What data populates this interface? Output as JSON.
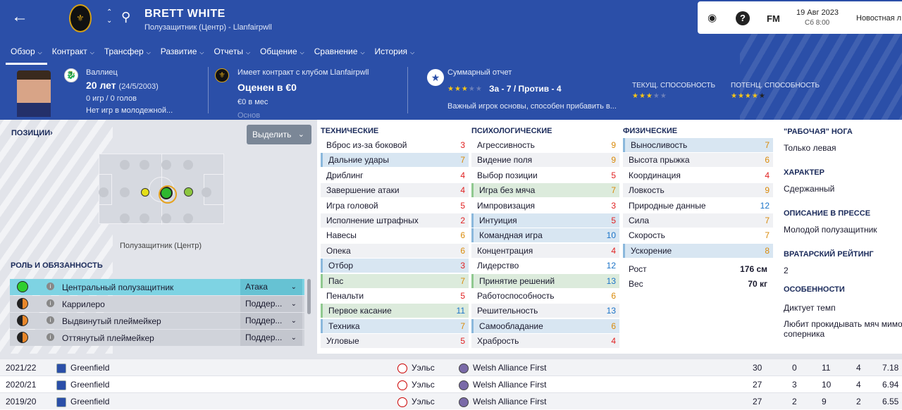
{
  "header": {
    "player_name": "BRETT WHITE",
    "player_sub": "Полузащитник (Центр) - Llanfairpwll",
    "date": "19 Авг 2023",
    "time": "Сб 8:00",
    "news": "Новостная л",
    "fm_label": "FM",
    "help_label": "?"
  },
  "nav": [
    {
      "label": "Обзор"
    },
    {
      "label": "Контракт"
    },
    {
      "label": "Трансфер"
    },
    {
      "label": "Развитие"
    },
    {
      "label": "Отчеты"
    },
    {
      "label": "Общение"
    },
    {
      "label": "Сравнение"
    },
    {
      "label": "История"
    }
  ],
  "info": {
    "nationality": "Валлиец",
    "age": "20 лет",
    "dob": "(24/5/2003)",
    "games": "0 игр / 0 голов",
    "youth": "Нет игр в молодежной...",
    "contract_label": "Имеет контракт с клубом Llanfairpwll",
    "value": "Оценен в €0",
    "wage": "€0 в мес",
    "extra": "Основ",
    "report_label": "Суммарный отчет",
    "report_for_against": "За - 7 / Против - 4",
    "report_text": "Важный игрок основы, способен прибавить в...",
    "ca_label": "ТЕКУЩ. СПОСОБНОСТЬ",
    "pa_label": "ПОТЕНЦ. СПОСОБНОСТЬ",
    "report_stars": 3,
    "ca_stars": 3,
    "pa_stars": 4.5
  },
  "positions": {
    "title": "ПОЗИЦИИ",
    "select_label": "Выделить",
    "position_name": "Полузащитник (Центр)"
  },
  "roles": {
    "title": "РОЛЬ И ОБЯЗАННОСТЬ",
    "items": [
      {
        "name": "Центральный полузащитник",
        "duty": "Атака"
      },
      {
        "name": "Каррилеро",
        "duty": "Поддер..."
      },
      {
        "name": "Выдвинутый плеймейкер",
        "duty": "Поддер..."
      },
      {
        "name": "Оттянутый плеймейкер",
        "duty": "Поддер..."
      }
    ]
  },
  "technical": {
    "title": "ТЕХНИЧЕСКИЕ",
    "items": [
      {
        "name": "Вброс из-за боковой",
        "value": "3"
      },
      {
        "name": "Дальние удары",
        "value": "7"
      },
      {
        "name": "Дриблинг",
        "value": "4"
      },
      {
        "name": "Завершение атаки",
        "value": "4"
      },
      {
        "name": "Игра головой",
        "value": "5"
      },
      {
        "name": "Исполнение штрафных",
        "value": "2"
      },
      {
        "name": "Навесы",
        "value": "6"
      },
      {
        "name": "Опека",
        "value": "6"
      },
      {
        "name": "Отбор",
        "value": "3"
      },
      {
        "name": "Пас",
        "value": "7"
      },
      {
        "name": "Пенальти",
        "value": "5"
      },
      {
        "name": "Первое касание",
        "value": "11"
      },
      {
        "name": "Техника",
        "value": "7"
      },
      {
        "name": "Угловые",
        "value": "5"
      }
    ]
  },
  "mental": {
    "title": "ПСИХОЛОГИЧЕСКИЕ",
    "items": [
      {
        "name": "Агрессивность",
        "value": "9"
      },
      {
        "name": "Видение поля",
        "value": "9"
      },
      {
        "name": "Выбор позиции",
        "value": "5"
      },
      {
        "name": "Игра без мяча",
        "value": "7"
      },
      {
        "name": "Импровизация",
        "value": "3"
      },
      {
        "name": "Интуиция",
        "value": "5"
      },
      {
        "name": "Командная игра",
        "value": "10"
      },
      {
        "name": "Концентрация",
        "value": "4"
      },
      {
        "name": "Лидерство",
        "value": "12"
      },
      {
        "name": "Принятие решений",
        "value": "13"
      },
      {
        "name": "Работоспособность",
        "value": "6"
      },
      {
        "name": "Решительность",
        "value": "13"
      },
      {
        "name": "Самообладание",
        "value": "6"
      },
      {
        "name": "Храбрость",
        "value": "4"
      }
    ]
  },
  "physical": {
    "title": "ФИЗИЧЕСКИЕ",
    "items": [
      {
        "name": "Выносливость",
        "value": "7"
      },
      {
        "name": "Высота прыжка",
        "value": "6"
      },
      {
        "name": "Координация",
        "value": "4"
      },
      {
        "name": "Ловкость",
        "value": "9"
      },
      {
        "name": "Природные данные",
        "value": "12"
      },
      {
        "name": "Сила",
        "value": "7"
      },
      {
        "name": "Скорость",
        "value": "7"
      },
      {
        "name": "Ускорение",
        "value": "8"
      }
    ],
    "height_label": "Рост",
    "height": "176 см",
    "weight_label": "Вес",
    "weight": "70 кг"
  },
  "side": {
    "foot_h": "\"РАБОЧАЯ\" НОГА",
    "foot_v": "Только левая",
    "char_h": "ХАРАКТЕР",
    "char_v": "Сдержанный",
    "press_h": "ОПИСАНИЕ В ПРЕССЕ",
    "press_v": "Молодой полузащитник",
    "gk_h": "ВРАТАРСКИЙ РЕЙТИНГ",
    "gk_v": "2",
    "traits_h": "ОСОБЕННОСТИ",
    "trait1": "Диктует темп",
    "trait2a": "Любит прокидывать мяч мимо",
    "trait2b": "соперника"
  },
  "history": [
    {
      "season": "2021/22",
      "club": "Greenfield",
      "country": "Уэльс",
      "league": "Welsh Alliance First",
      "apps": "30",
      "goals": "0",
      "c1": "11",
      "c2": "4",
      "rating": "7.18"
    },
    {
      "season": "2020/21",
      "club": "Greenfield",
      "country": "Уэльс",
      "league": "Welsh Alliance First",
      "apps": "27",
      "goals": "3",
      "c1": "10",
      "c2": "4",
      "rating": "6.94"
    },
    {
      "season": "2019/20",
      "club": "Greenfield",
      "country": "Уэльс",
      "league": "Welsh Alliance First",
      "apps": "27",
      "goals": "2",
      "c1": "9",
      "c2": "2",
      "rating": "6.55"
    }
  ],
  "colors": {
    "header_bg": "#2b4fa8",
    "attr_red": "#e02020",
    "attr_orange": "#d98a0a",
    "attr_blue": "#1a73c8"
  }
}
